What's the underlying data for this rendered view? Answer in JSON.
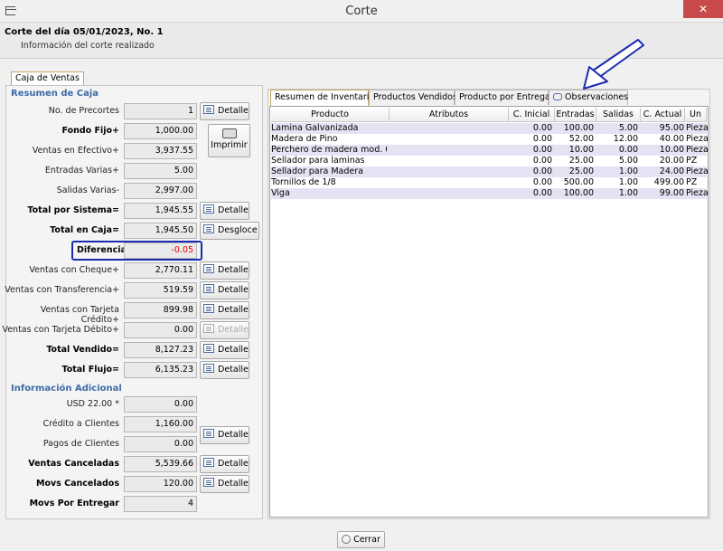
{
  "window": {
    "title": "Corte",
    "close_symbol": "✕"
  },
  "header": {
    "title": "Corte del día 05/01/2023, No. 1",
    "subtitle": "Información del corte realizado"
  },
  "left_tab": "Caja de Ventas",
  "caja": {
    "section_resumen": "Resumen de Caja",
    "section_info": "Información Adicional",
    "rows": [
      {
        "label": "No. de Precortes",
        "value": "1",
        "bold": false
      },
      {
        "label": "Fondo Fijo+",
        "value": "1,000.00",
        "bold": true
      },
      {
        "label": "Ventas en Efectivo+",
        "value": "3,937.55",
        "bold": false
      },
      {
        "label": "Entradas Varias+",
        "value": "5.00",
        "bold": false
      },
      {
        "label": "Salidas Varias-",
        "value": "2,997.00",
        "bold": false
      },
      {
        "label": "Total por Sistema=",
        "value": "1,945.55",
        "bold": true
      },
      {
        "label": "Total en Caja=",
        "value": "1,945.50",
        "bold": true
      },
      {
        "label": "Diferencia",
        "value": "-0.05",
        "bold": true
      },
      {
        "label": "Ventas con Cheque+",
        "value": "2,770.11",
        "bold": false
      },
      {
        "label": "Ventas con Transferencia+",
        "value": "519.59",
        "bold": false
      },
      {
        "label": "Ventas con Tarjeta Crédito+",
        "value": "899.98",
        "bold": false
      },
      {
        "label": "Ventas con Tarjeta Débito+",
        "value": "0.00",
        "bold": false
      },
      {
        "label": "Total Vendido=",
        "value": "8,127.23",
        "bold": true
      },
      {
        "label": "Total Flujo=",
        "value": "6,135.23",
        "bold": true
      }
    ],
    "extra_rows": [
      {
        "label": "USD 22.00 *",
        "value": "0.00",
        "bold": false
      },
      {
        "label": "Crédito a Clientes",
        "value": "1,160.00",
        "bold": false
      },
      {
        "label": "Pagos de Clientes",
        "value": "0.00",
        "bold": false
      },
      {
        "label": "Ventas Canceladas",
        "value": "5,539.66",
        "bold": true
      },
      {
        "label": "Movs Cancelados",
        "value": "120.00",
        "bold": true
      },
      {
        "label": "Movs Por Entregar",
        "value": "4",
        "bold": true
      }
    ],
    "detalle_label": "Detalle",
    "desgloce_label": "Desgloce",
    "imprimir_label": "Imprimir"
  },
  "right_tabs": [
    "Resumen de Inventario",
    "Productos Vendidos",
    "Producto por Entregar",
    "Observaciones"
  ],
  "inventory": {
    "columns": [
      "Producto",
      "Atributos",
      "C. Inicial",
      "Entradas",
      "Salidas",
      "C. Actual",
      "Un"
    ],
    "rows": [
      [
        "Lamina Galvanizada",
        "",
        "0.00",
        "100.00",
        "5.00",
        "95.00",
        "Pieza"
      ],
      [
        "Madera de Pino",
        "",
        "0.00",
        "52.00",
        "12.00",
        "40.00",
        "Pieza"
      ],
      [
        "Perchero de madera mod. 0...",
        "",
        "0.00",
        "10.00",
        "0.00",
        "10.00",
        "Pieza"
      ],
      [
        "Sellador para laminas",
        "",
        "0.00",
        "25.00",
        "5.00",
        "20.00",
        "PZ"
      ],
      [
        "Sellador para Madera",
        "",
        "0.00",
        "25.00",
        "1.00",
        "24.00",
        "Pieza"
      ],
      [
        "Tornillos de 1/8",
        "",
        "0.00",
        "500.00",
        "1.00",
        "499.00",
        "PZ"
      ],
      [
        "Viga",
        "",
        "0.00",
        "100.00",
        "1.00",
        "99.00",
        "Pieza"
      ]
    ]
  },
  "footer": {
    "close_label": "Cerrar"
  },
  "colors": {
    "highlight_border": "#1a2bb3",
    "negative": "#e00000",
    "section_title": "#3e6aa8"
  }
}
